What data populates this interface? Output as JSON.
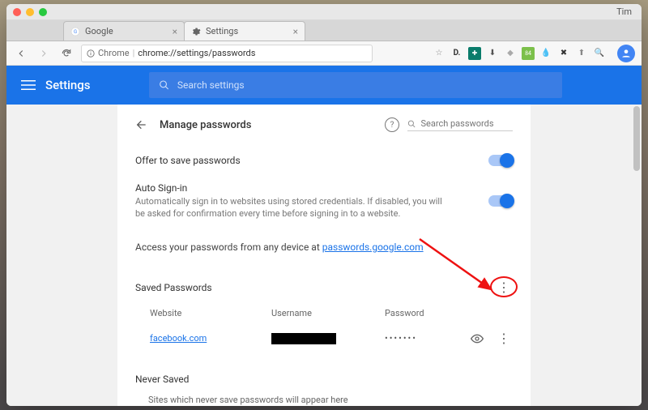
{
  "os_user": "Tim",
  "tabs": [
    {
      "label": "Google",
      "favicon": "G"
    },
    {
      "label": "Settings",
      "favicon": "gear"
    }
  ],
  "addressbar": {
    "scheme_label": "Chrome",
    "path": "chrome://settings/passwords"
  },
  "header": {
    "title": "Settings",
    "search_placeholder": "Search settings"
  },
  "page": {
    "title": "Manage passwords",
    "search_passwords_placeholder": "Search passwords",
    "offer_label": "Offer to save passwords",
    "autosignin_label": "Auto Sign-in",
    "autosignin_desc": "Automatically sign in to websites using stored credentials. If disabled, you will be asked for confirmation every time before signing in to a website.",
    "access_text_prefix": "Access your passwords from any device at ",
    "access_link": "passwords.google.com",
    "saved_title": "Saved Passwords",
    "columns": {
      "website": "Website",
      "username": "Username",
      "password": "Password"
    },
    "entries": [
      {
        "site": "facebook.com",
        "password_mask": "•••••••"
      }
    ],
    "never_title": "Never Saved",
    "never_desc": "Sites which never save passwords will appear here"
  }
}
